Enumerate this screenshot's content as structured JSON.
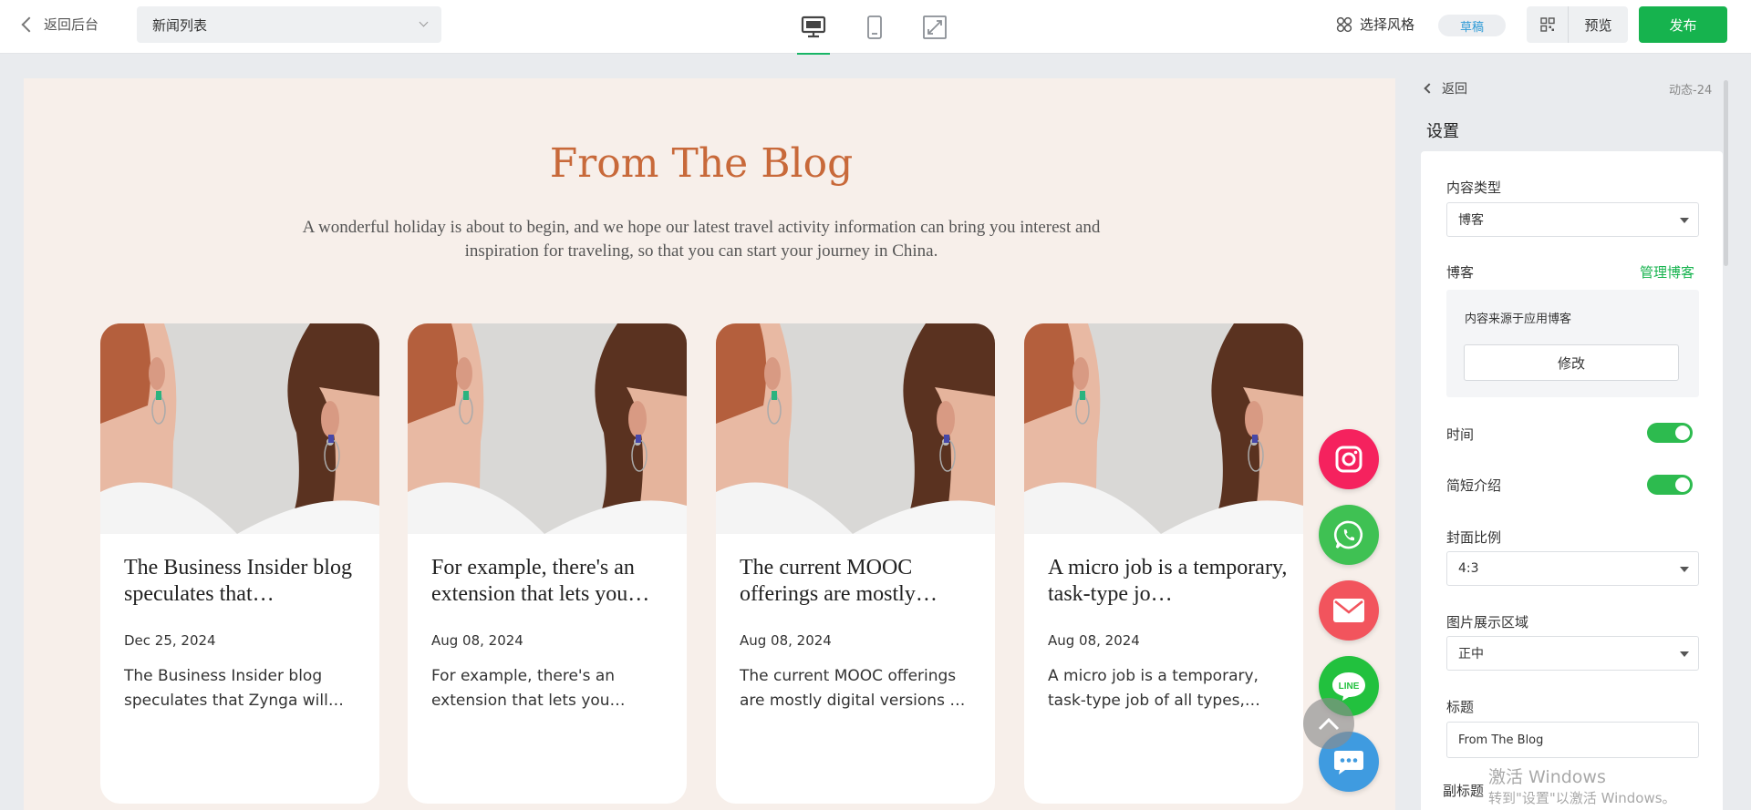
{
  "topbar": {
    "back_label": "返回后台",
    "page_select_value": "新闻列表",
    "devices": [
      "desktop-icon",
      "mobile-icon",
      "fullscreen-icon"
    ],
    "style_label": "选择风格",
    "draft_badge": "草稿",
    "preview_label": "预览",
    "publish_label": "发布"
  },
  "canvas": {
    "title": "From The Blog",
    "subtitle": "A wonderful holiday is about to begin, and we hope our latest travel activity information can bring you interest and inspiration for traveling, so that you can start your journey in China.",
    "cards": [
      {
        "title": "The Business Insider blog speculates that…",
        "date": "Dec 25, 2024",
        "desc": "The Business Insider blog speculates that Zynga will…"
      },
      {
        "title": "For example, there's an extension that lets you…",
        "date": "Aug 08, 2024",
        "desc": "For example, there's an extension that lets you…"
      },
      {
        "title": "The current MOOC offerings are mostly…",
        "date": "Aug 08, 2024",
        "desc": "The current MOOC offerings are mostly digital versions …"
      },
      {
        "title": "A micro job is a temporary, task-type jo…",
        "date": "Aug 08, 2024",
        "desc": "A micro job is a temporary, task-type job of all types,…"
      }
    ],
    "floating_buttons": [
      {
        "name": "instagram-icon",
        "color": "#f5225e"
      },
      {
        "name": "whatsapp-icon",
        "color": "#3fc153"
      },
      {
        "name": "email-icon",
        "color": "#f2545d"
      },
      {
        "name": "line-icon",
        "color": "#22c13e",
        "label": "LINE"
      },
      {
        "name": "chat-icon",
        "color": "#3f9be0"
      }
    ]
  },
  "panel": {
    "back_label": "返回",
    "component_id": "动态-24",
    "heading": "设置",
    "content_type_label": "内容类型",
    "content_type_value": "博客",
    "blog_label": "博客",
    "manage_blog_label": "管理博客",
    "source_text": "内容来源于应用博客",
    "modify_label": "修改",
    "time_label": "时间",
    "time_on": true,
    "intro_label": "简短介绍",
    "intro_on": true,
    "cover_ratio_label": "封面比例",
    "cover_ratio_value": "4:3",
    "image_area_label": "图片展示区域",
    "image_area_value": "正中",
    "title_label": "标题",
    "title_value": "From The Blog",
    "subtitle_label": "副标题"
  },
  "watermark": {
    "line1": "激活 Windows",
    "line2": "转到\"设置\"以激活 Windows。"
  },
  "colors": {
    "brand_green": "#16b34e",
    "blog_title": "#c8693a",
    "canvas_bg": "#f7efea",
    "draft_text": "#2f9bd6"
  }
}
